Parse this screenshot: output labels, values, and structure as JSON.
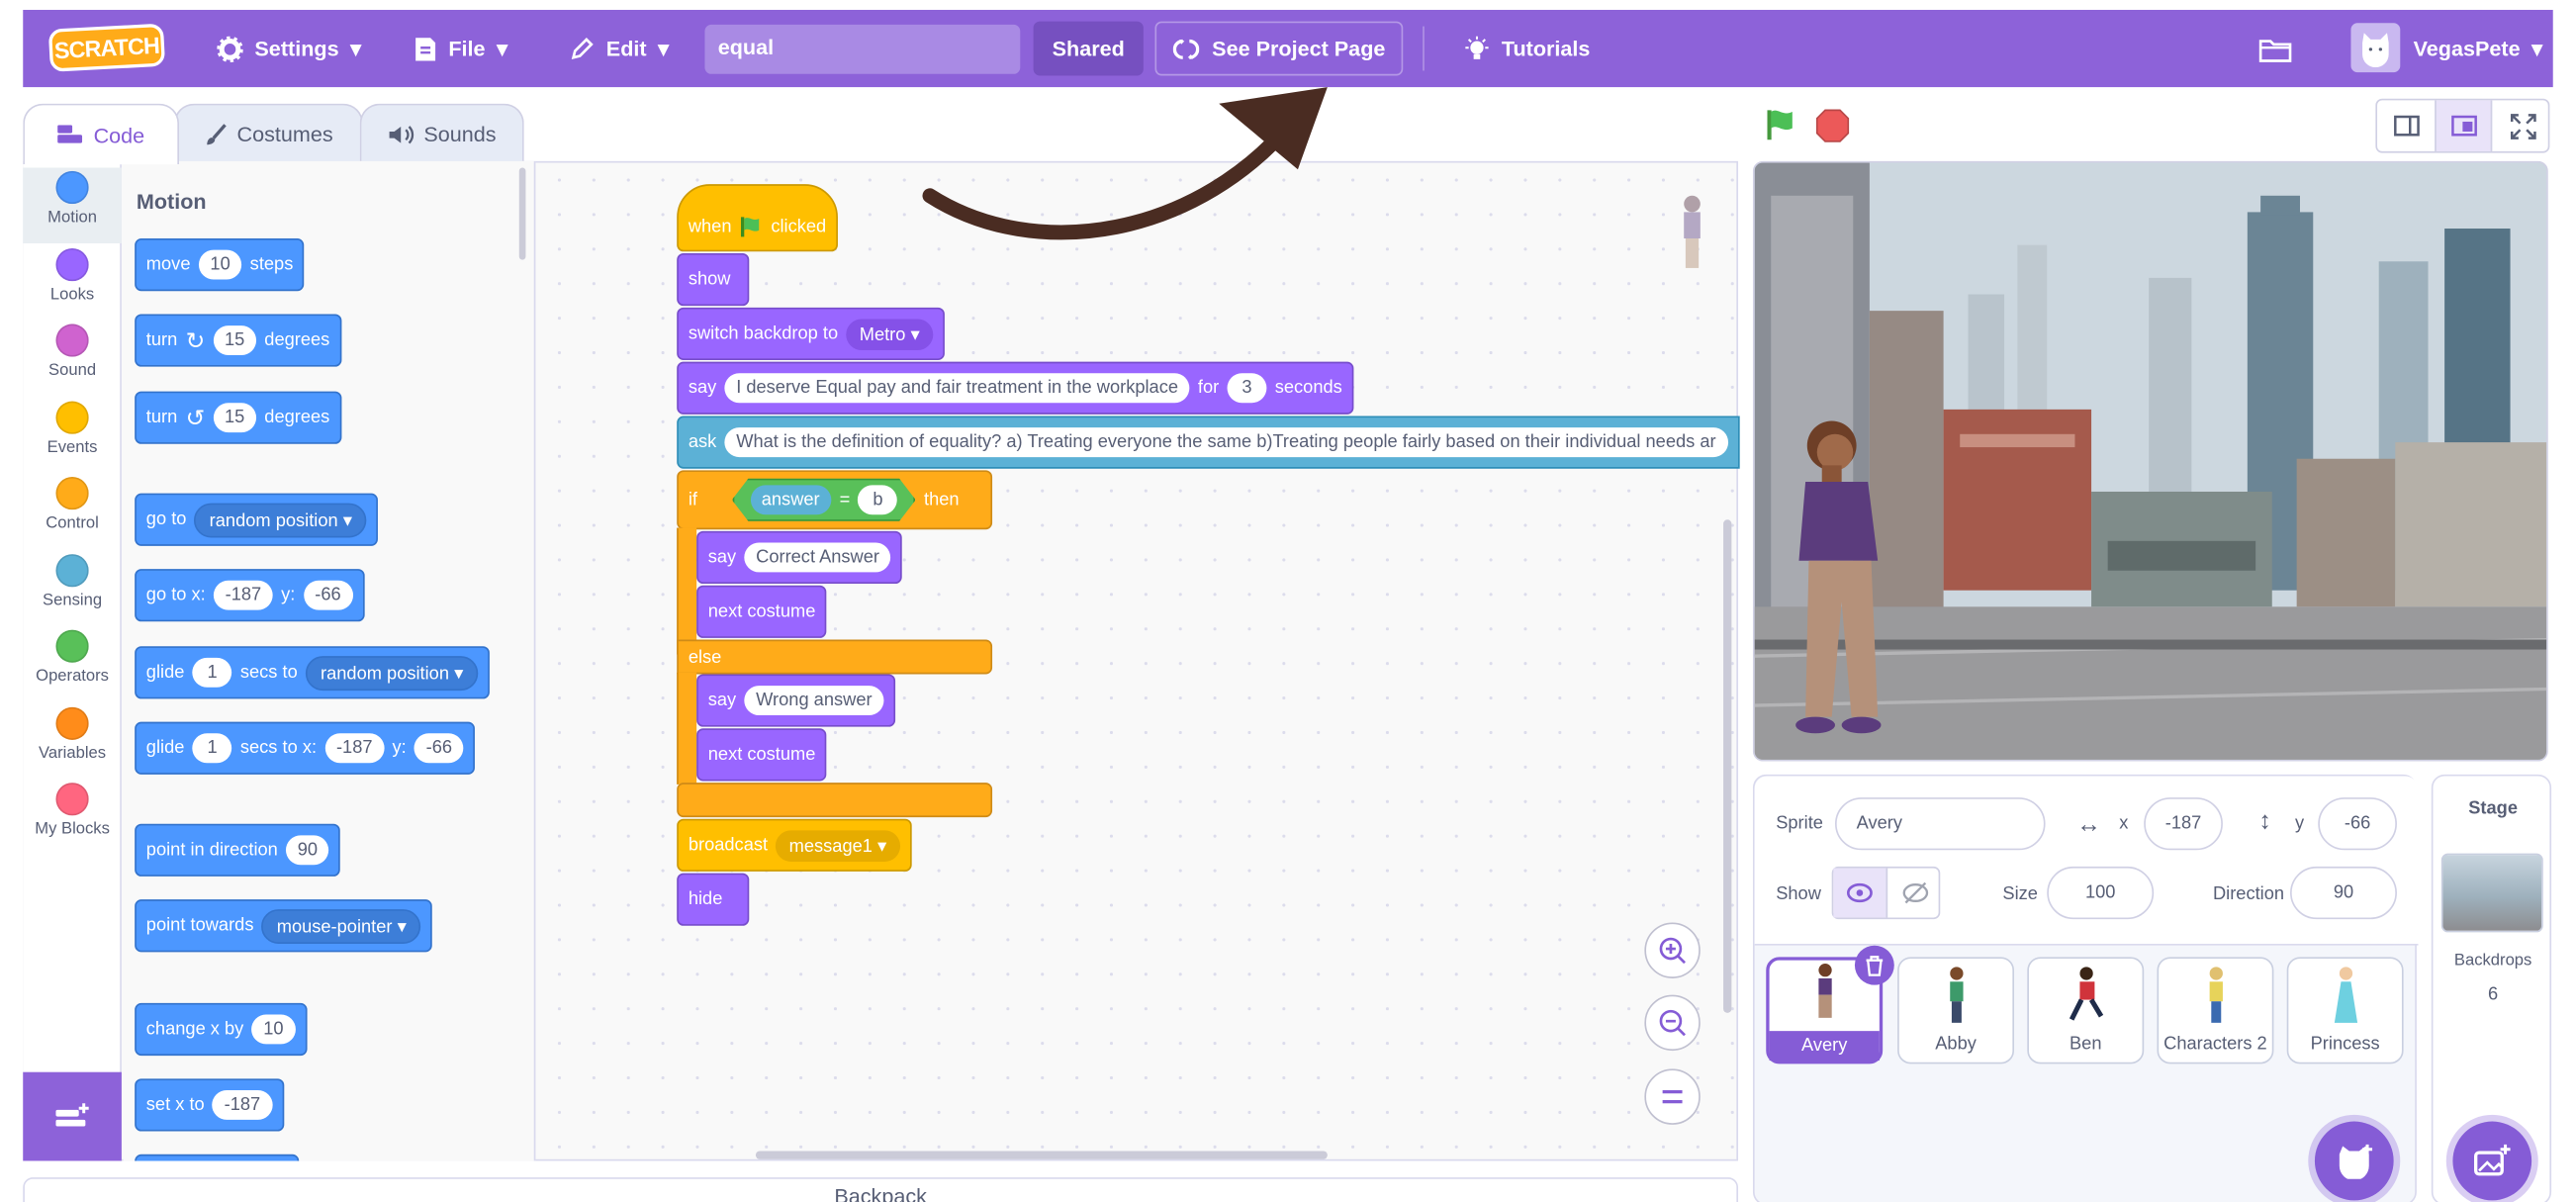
{
  "menu": {
    "logo": "SCRATCH",
    "settings": "Settings",
    "file": "File",
    "edit": "Edit",
    "project_title": "equal",
    "shared": "Shared",
    "see_project_page": "See Project Page",
    "tutorials": "Tutorials",
    "username": "VegasPete"
  },
  "tabs": {
    "code": "Code",
    "costumes": "Costumes",
    "sounds": "Sounds"
  },
  "categories": [
    {
      "label": "Motion",
      "color": "#4c97ff"
    },
    {
      "label": "Looks",
      "color": "#9966ff"
    },
    {
      "label": "Sound",
      "color": "#cf63cf"
    },
    {
      "label": "Events",
      "color": "#ffbf00"
    },
    {
      "label": "Control",
      "color": "#ffab19"
    },
    {
      "label": "Sensing",
      "color": "#5cb1d6"
    },
    {
      "label": "Operators",
      "color": "#59c059"
    },
    {
      "label": "Variables",
      "color": "#ff8c1a"
    },
    {
      "label": "My Blocks",
      "color": "#ff6680"
    }
  ],
  "palette": {
    "heading": "Motion",
    "move": "move",
    "move_val": "10",
    "steps": "steps",
    "turn": "turn",
    "turn_right_val": "15",
    "degrees": "degrees",
    "turn_left_val": "15",
    "goto": "go to",
    "random_position": "random position",
    "goto_x": "go to x:",
    "x_val": "-187",
    "y": "y:",
    "y_val": "-66",
    "glide": "glide",
    "glide_val": "1",
    "secs_to": "secs to",
    "secs_to_x": "secs to x:",
    "point_dir": "point in direction",
    "dir_val": "90",
    "point_towards": "point towards",
    "mouse_pointer": "mouse-pointer",
    "change_x": "change x by",
    "change_val": "10",
    "set_x": "set x to",
    "set_val": "-187"
  },
  "script": {
    "when": "when",
    "clicked": "clicked",
    "show": "show",
    "switch_backdrop": "switch backdrop to",
    "backdrop": "Metro",
    "say": "say",
    "say_text": "I deserve Equal pay and fair treatment in the workplace",
    "for": "for",
    "secs": "3",
    "seconds": "seconds",
    "ask": "ask",
    "ask_text": "What is the definition of equality?    a) Treating everyone the same   b)Treating people fairly based on their individual needs ar",
    "if": "if",
    "answer": "answer",
    "eq": "=",
    "b": "b",
    "then": "then",
    "correct": "Correct Answer",
    "next_costume": "next costume",
    "else": "else",
    "wrong": "Wrong answer",
    "broadcast": "broadcast",
    "message": "message1",
    "hide": "hide"
  },
  "backpack": "Backpack",
  "sprite_info": {
    "sprite_label": "Sprite",
    "sprite_name": "Avery",
    "x_label": "x",
    "x": "-187",
    "y_label": "y",
    "y": "-66",
    "show_label": "Show",
    "size_label": "Size",
    "size": "100",
    "direction_label": "Direction",
    "direction": "90"
  },
  "sprites": [
    "Avery",
    "Abby",
    "Ben",
    "Characters 2",
    "Princess"
  ],
  "stage_pane": {
    "title": "Stage",
    "backdrops_label": "Backdrops",
    "backdrops_count": "6"
  }
}
